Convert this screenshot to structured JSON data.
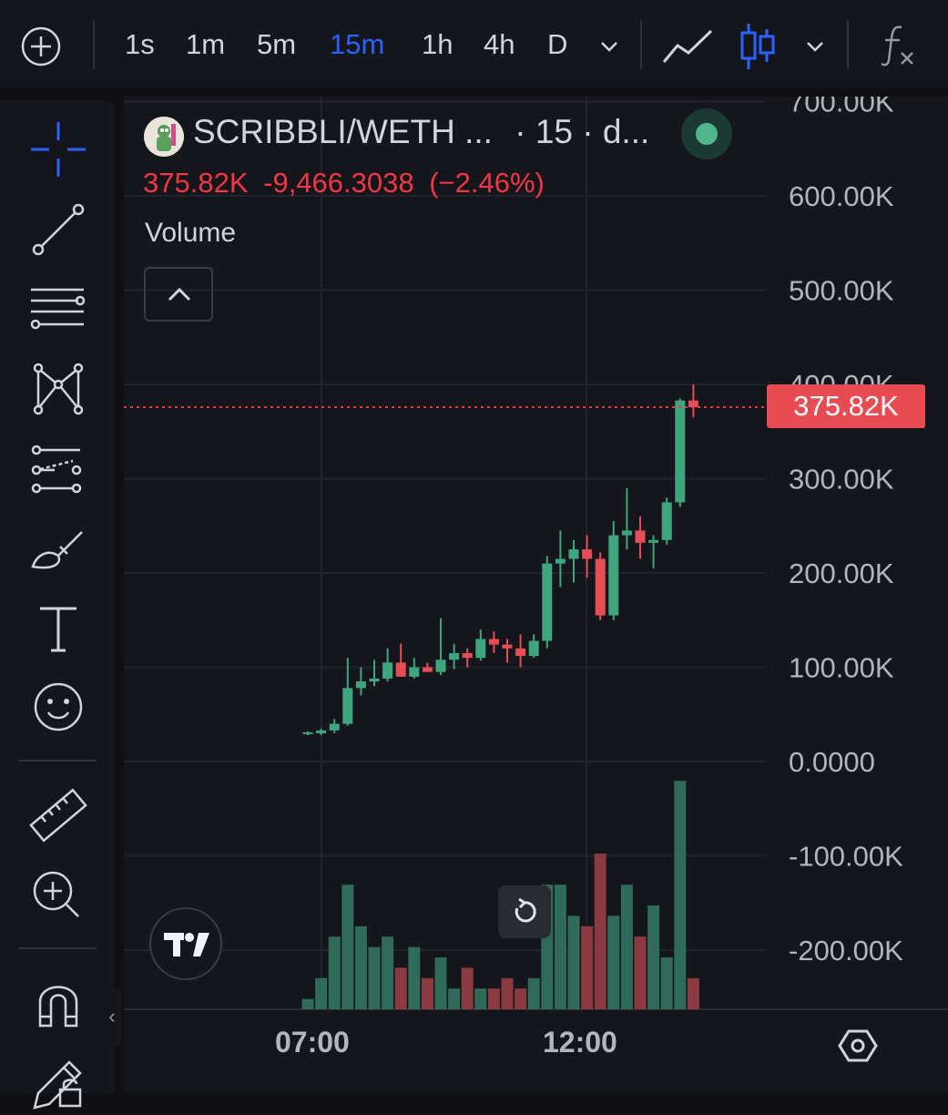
{
  "toolbar": {
    "add_icon": "plus-circle-icon",
    "intervals": [
      "1s",
      "1m",
      "5m",
      "15m",
      "1h",
      "4h",
      "D"
    ],
    "active_interval": "15m",
    "chart_style_icons": [
      "line-chart-icon",
      "candlestick-icon"
    ],
    "indicators_icon": "fx-icon"
  },
  "sidebar": {
    "tools": [
      "crosshair-icon",
      "trend-line-icon",
      "fib-retracement-icon",
      "pattern-icon",
      "prediction-icon",
      "brush-icon",
      "text-icon",
      "emoji-icon",
      "ruler-icon",
      "zoom-in-icon",
      "magnet-icon",
      "lock-pencil-icon"
    ]
  },
  "legend": {
    "symbol": "SCRIBBLI/WETH ...",
    "meta": "· 15 · d...",
    "price": "375.82K",
    "change": "-9,466.3038",
    "change_pct": "(−2.46%)",
    "volume_label": "Volume"
  },
  "price_scale": {
    "labels": [
      "700.00K",
      "600.00K",
      "500.00K",
      "400.00K",
      "300.00K",
      "200.00K",
      "100.00K",
      "0.0000",
      "-100.00K",
      "-200.00K"
    ],
    "current_price_tag": "375.82K"
  },
  "time_axis": {
    "labels": [
      "07:00",
      "12:00"
    ]
  },
  "colors": {
    "up": "#3fa57f",
    "down": "#e54e56",
    "accent": "#2962ff",
    "price_line": "#f23645"
  },
  "chart_data": {
    "type": "candlestick",
    "interval": "15m",
    "ylim": [
      -260000,
      710000
    ],
    "x_ticks": [
      "07:00",
      "12:00"
    ],
    "candles": [
      {
        "o": 30000,
        "h": 32000,
        "l": 28000,
        "c": 31000
      },
      {
        "o": 30000,
        "h": 35000,
        "l": 28000,
        "c": 33000
      },
      {
        "o": 33000,
        "h": 45000,
        "l": 30000,
        "c": 40000
      },
      {
        "o": 40000,
        "h": 110000,
        "l": 38000,
        "c": 78000
      },
      {
        "o": 78000,
        "h": 100000,
        "l": 70000,
        "c": 85000
      },
      {
        "o": 85000,
        "h": 108000,
        "l": 80000,
        "c": 88000
      },
      {
        "o": 88000,
        "h": 120000,
        "l": 85000,
        "c": 105000
      },
      {
        "o": 105000,
        "h": 125000,
        "l": 90000,
        "c": 90000
      },
      {
        "o": 90000,
        "h": 110000,
        "l": 88000,
        "c": 100000
      },
      {
        "o": 100000,
        "h": 105000,
        "l": 95000,
        "c": 95000
      },
      {
        "o": 95000,
        "h": 152000,
        "l": 92000,
        "c": 108000
      },
      {
        "o": 108000,
        "h": 125000,
        "l": 98000,
        "c": 115000
      },
      {
        "o": 115000,
        "h": 120000,
        "l": 100000,
        "c": 110000
      },
      {
        "o": 110000,
        "h": 140000,
        "l": 107000,
        "c": 130000
      },
      {
        "o": 130000,
        "h": 138000,
        "l": 115000,
        "c": 124000
      },
      {
        "o": 124000,
        "h": 130000,
        "l": 105000,
        "c": 120000
      },
      {
        "o": 120000,
        "h": 135000,
        "l": 100000,
        "c": 112000
      },
      {
        "o": 112000,
        "h": 135000,
        "l": 110000,
        "c": 128000
      },
      {
        "o": 128000,
        "h": 218000,
        "l": 120000,
        "c": 210000
      },
      {
        "o": 210000,
        "h": 245000,
        "l": 185000,
        "c": 215000
      },
      {
        "o": 215000,
        "h": 235000,
        "l": 190000,
        "c": 225000
      },
      {
        "o": 225000,
        "h": 240000,
        "l": 195000,
        "c": 215000
      },
      {
        "o": 215000,
        "h": 222000,
        "l": 150000,
        "c": 155000
      },
      {
        "o": 155000,
        "h": 255000,
        "l": 150000,
        "c": 240000
      },
      {
        "o": 240000,
        "h": 290000,
        "l": 225000,
        "c": 245000
      },
      {
        "o": 245000,
        "h": 260000,
        "l": 215000,
        "c": 232000
      },
      {
        "o": 232000,
        "h": 240000,
        "l": 205000,
        "c": 235000
      },
      {
        "o": 235000,
        "h": 280000,
        "l": 230000,
        "c": 275000
      },
      {
        "o": 275000,
        "h": 385000,
        "l": 270000,
        "c": 383000
      },
      {
        "o": 383000,
        "h": 400000,
        "l": 365000,
        "c": 375820
      }
    ],
    "volume": [
      1,
      3,
      7,
      12,
      8,
      6,
      7,
      4,
      6,
      3,
      5,
      2,
      4,
      2,
      2,
      3,
      2,
      3,
      12,
      12,
      9,
      8,
      15,
      9,
      12,
      7,
      10,
      5,
      22,
      3
    ]
  }
}
